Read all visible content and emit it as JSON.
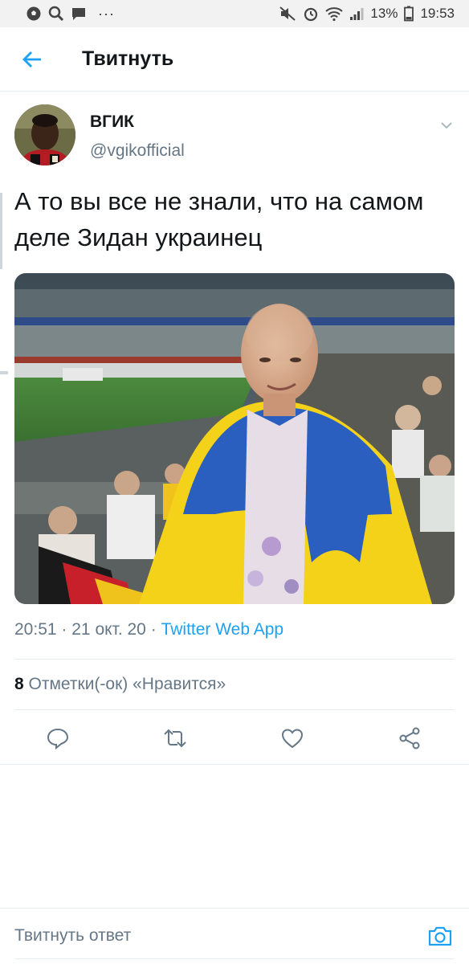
{
  "status_bar": {
    "battery": "13%",
    "time": "19:53",
    "dots": "···"
  },
  "header": {
    "title": "Твитнуть"
  },
  "tweet": {
    "display_name": "ВГИК",
    "handle": "@vgikofficial",
    "text": "А то вы все не знали, что на самом деле Зидан украинец",
    "time": "20:51",
    "date": "21 окт. 20",
    "separator": "·",
    "source": "Twitter Web App",
    "likes_count": "8",
    "likes_label": "Отметки(-ок) «Нравится»"
  },
  "reply": {
    "placeholder": "Твитнуть ответ"
  },
  "icons": {
    "back": "back-arrow-icon",
    "caret": "chevron-down-icon",
    "reply": "reply-icon",
    "retweet": "retweet-icon",
    "like": "heart-icon",
    "share": "share-icon",
    "camera": "camera-icon"
  },
  "colors": {
    "accent": "#1da1f2",
    "secondary_text": "#657786",
    "divider": "#e6ecf0"
  }
}
